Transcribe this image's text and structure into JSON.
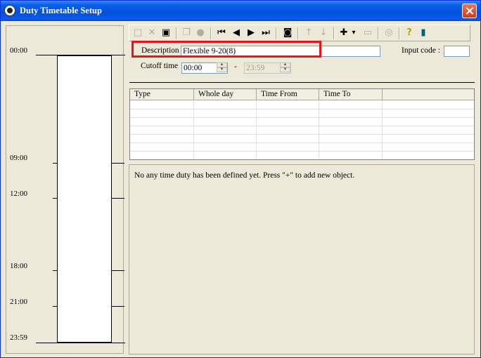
{
  "window": {
    "title": "Duty Timetable Setup"
  },
  "timeline": {
    "labels": [
      "00:00",
      "09:00",
      "12:00",
      "18:00",
      "21:00",
      "23:59"
    ]
  },
  "toolbar": {
    "buttons": [
      {
        "name": "new-icon",
        "glyph": "□",
        "enabled": false
      },
      {
        "name": "delete-icon",
        "glyph": "✕",
        "enabled": false
      },
      {
        "name": "save-icon",
        "glyph": "▣",
        "enabled": true
      },
      {
        "name": "copy-icon",
        "glyph": "❐",
        "enabled": false
      },
      {
        "name": "record-icon",
        "glyph": "●",
        "enabled": false
      },
      {
        "name": "first-icon",
        "glyph": "⏮",
        "enabled": true
      },
      {
        "name": "prev-icon",
        "glyph": "◀",
        "enabled": true
      },
      {
        "name": "next-icon",
        "glyph": "▶",
        "enabled": true
      },
      {
        "name": "last-icon",
        "glyph": "⏭",
        "enabled": true
      },
      {
        "name": "find-icon",
        "glyph": "◙",
        "enabled": true
      },
      {
        "name": "arrow-up-icon",
        "glyph": "↑",
        "enabled": false
      },
      {
        "name": "arrow-down-icon",
        "glyph": "↓",
        "enabled": false
      },
      {
        "name": "add-icon",
        "glyph": "✚",
        "enabled": true
      },
      {
        "name": "dropdown-icon",
        "glyph": "▾",
        "enabled": true
      },
      {
        "name": "remove-icon",
        "glyph": "▭",
        "enabled": false
      },
      {
        "name": "refresh-icon",
        "glyph": "◎",
        "enabled": false
      },
      {
        "name": "help-icon",
        "glyph": "?",
        "enabled": true
      },
      {
        "name": "exit-icon",
        "glyph": "▮",
        "enabled": true
      }
    ]
  },
  "form": {
    "description_label": "Description",
    "description_value": "Flexible 9-20(8)",
    "input_code_label": "Input code :",
    "input_code_value": "",
    "cutoff_label": "Cutoff time",
    "cutoff_from": "00:00",
    "cutoff_sep": "-",
    "cutoff_to": "23:59"
  },
  "grid": {
    "columns": [
      "Type",
      "Whole day",
      "Time From",
      "Time To",
      ""
    ]
  },
  "message": "No any time duty has been defined yet. Press \"+\" to add new object."
}
